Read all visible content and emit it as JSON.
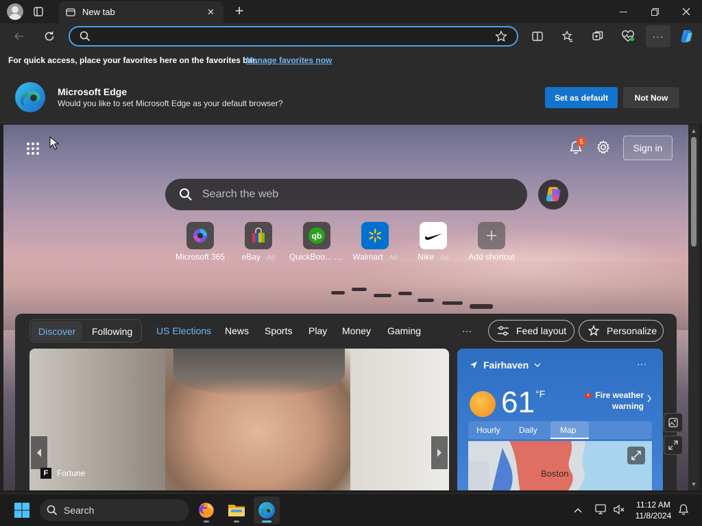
{
  "window": {
    "tab_title": "New tab",
    "new_tab_symbol": "+",
    "minimize_symbol": "—",
    "maximize_symbol": "❐",
    "close_symbol": "✕"
  },
  "toolbar": {
    "address_value": "",
    "address_placeholder": ""
  },
  "favorites_bar": {
    "message": "For quick access, place your favorites here on the favorites bar.",
    "link": "Manage favorites now"
  },
  "default_banner": {
    "title": "Microsoft Edge",
    "subtitle": "Would you like to set Microsoft Edge as your default browser?",
    "primary_button": "Set as default",
    "secondary_button": "Not Now"
  },
  "header": {
    "notification_count": "5",
    "sign_in": "Sign in"
  },
  "web_search": {
    "placeholder": "Search the web"
  },
  "shortcuts": [
    {
      "label": "Microsoft 365",
      "ad": ""
    },
    {
      "label": "eBay",
      "ad": "· Ad"
    },
    {
      "label": "QuickBoo...",
      "ad": "· Ad"
    },
    {
      "label": "Walmart",
      "ad": "· Ad"
    },
    {
      "label": "Nike",
      "ad": "· Ad"
    },
    {
      "label": "Add shortcut",
      "ad": ""
    }
  ],
  "feed": {
    "segments": [
      "Discover",
      "Following"
    ],
    "nav": [
      "US Elections",
      "News",
      "Sports",
      "Play",
      "Money",
      "Gaming"
    ],
    "more": "···",
    "feed_layout": "Feed layout",
    "personalize": "Personalize",
    "hero_source": "Fortune",
    "hero_source_logo": "F"
  },
  "weather": {
    "location": "Fairhaven",
    "temperature": "61",
    "unit": "°F",
    "warning": "Fire weather warning",
    "tabs": [
      "Hourly",
      "Daily",
      "Map"
    ],
    "map_city": "Boston",
    "more": "···"
  },
  "taskbar": {
    "search_label": "Search",
    "time": "11:12 AM",
    "date": "11/8/2024"
  },
  "colors": {
    "accent": "#1473cc",
    "link": "#6fb4f0",
    "address_focus": "#4aa0ee",
    "nav_highlight": "#6fb4f0",
    "notification": "#e8562a"
  }
}
